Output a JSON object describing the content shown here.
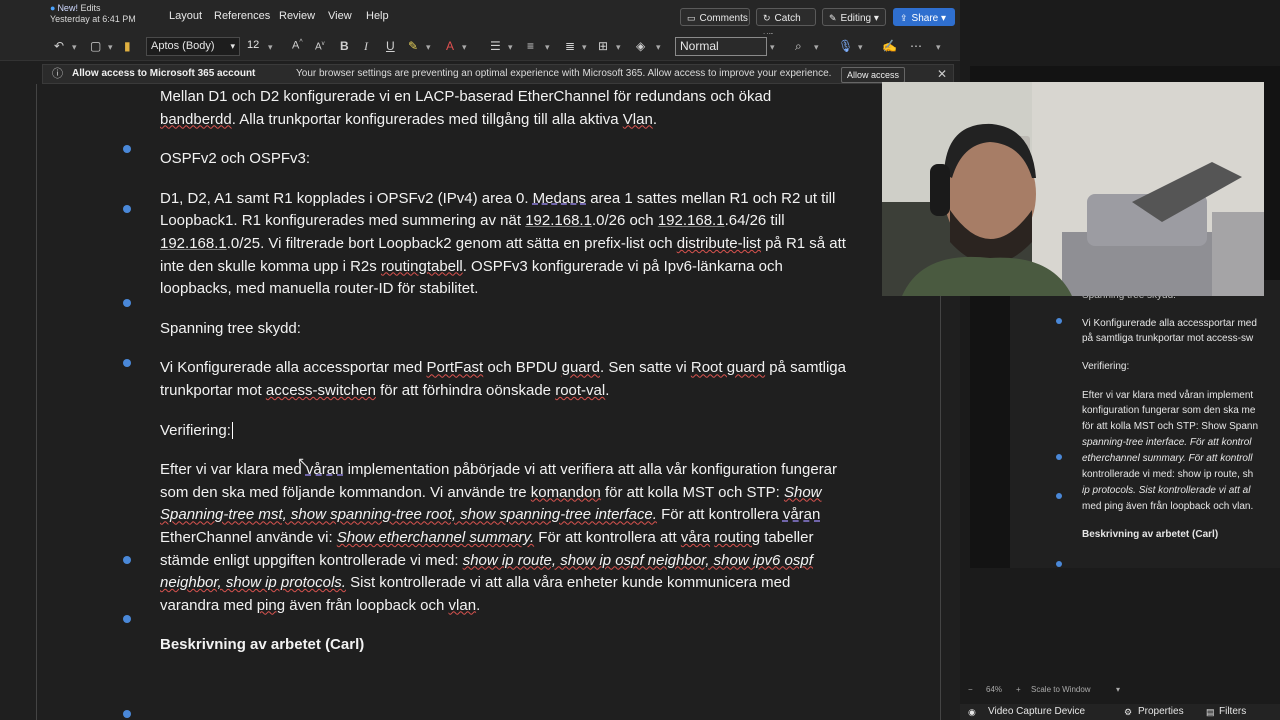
{
  "app": {
    "status_new": "New!",
    "status_edits": "Edits",
    "status_saved": "Yesterday at 6:41 PM"
  },
  "menu": [
    "Layout",
    "References",
    "Review",
    "View",
    "Help"
  ],
  "ribbon_buttons": {
    "comments": "Comments",
    "catch_up": "Catch up",
    "editing": "Editing",
    "share": "Share"
  },
  "toolbar": {
    "font_name": "Aptos (Body)",
    "font_size": "12",
    "style": "Normal"
  },
  "banner": {
    "title": "Allow access to Microsoft 365 account",
    "message": "Your browser settings are preventing an optimal experience with Microsoft 365. Allow access to improve your experience.",
    "button": "Allow access"
  },
  "document": {
    "p1a": "Mellan D1 och D2 konfigurerade vi en LACP-baserad EtherChannel för redundans och ökad",
    "p1b_w": "bandberdd",
    "p1b_rest": ". Alla trunkportar konfigurerades med tillgång till alla aktiva ",
    "p1b_vlan": "Vlan",
    "p1b_end": ".",
    "h_ospf": "OSPFv2 och OSPFv3:",
    "ospf": [
      "D1, D2, A1 samt R1 kopplades i OPSFv2 (IPv4) area 0. ",
      "Medans",
      " area 1 sattes mellan R1 och R2 ut till Loopback1. R1 konfigurerades med summering av nät ",
      "192.168.1",
      ".0/26 och ",
      "192.168.1",
      ".64/26 till ",
      "192.168.1",
      ".0/25. Vi filtrerade bort Loopback2 genom att sätta en prefix-list och ",
      "distribute-list",
      " på R1 så att inte den skulle komma upp i R2s ",
      "routingtabell",
      ". OSPFv3 konfigurerade vi på Ipv6-länkarna och loopbacks, med manuella router-ID för stabilitet."
    ],
    "h_stp": "Spanning tree skydd:",
    "stp": [
      "Vi Konfigurerade alla accessportar med ",
      "PortFast",
      " och BPDU ",
      "guard",
      ". Sen satte vi ",
      "Root guard",
      " på samtliga trunkportar mot ",
      "access-switchen",
      " för att förhindra oönskade ",
      "root-val",
      "."
    ],
    "h_verif": "Verifiering:",
    "verif": [
      "Efter vi var klara med ",
      "våran",
      " implementation påbörjade vi att verifiera att alla vår konfiguration fungerar som den ska med följande kommandon. Vi använde tre ",
      "komandon",
      " för att kolla MST och STP: ",
      "Show Spanning-tree mst, show spanning-tree root, show spanning-tree interface.",
      " För att kontrollera ",
      "våran",
      " EtherChannel använde vi: ",
      "Show etherchannel summary.",
      " För att kontrollera att ",
      "våra",
      " ",
      "routing",
      " tabeller stämde enligt uppgiften kontrollerade vi med: ",
      "show ip route, show ip ospf neighbor, show ipv6 ospf neighbor, show ip protocols.",
      " Sist kontrollerade vi att alla våra enheter kunde kommunicera med varandra med ",
      "ping",
      " även från loopback och ",
      "vlan",
      "."
    ],
    "h_carl": "Beskrivning av arbetet (Carl)"
  },
  "obs": {
    "mini_lines": [
      "Spanning tree skydd:",
      "Vi Konfigurerade alla accessportar med",
      "på samtliga trunkportar mot access-sw",
      "Verifiering:",
      "Efter vi var klara med våran implement",
      "konfiguration fungerar som den ska me",
      "för att kolla MST och STP: Show Spann",
      "spanning-tree interface. För att kontrol",
      "etherchannel summary. För att kontroll",
      "kontrollerade vi med: show ip route, sh",
      "ip protocols. Sist kontrollerade vi att al",
      "med ping även från loopback och vlan.",
      "Beskrivning av arbetet (Carl)"
    ],
    "zoom": "64%",
    "scale": "Scale to Window",
    "source": "Video Capture Device",
    "properties": "Properties",
    "filters": "Filters"
  },
  "colors": {
    "accent_blue": "#2f6fcf",
    "bullet_blue": "#4a88d8",
    "spell_red": "#d9534f",
    "grammar_purple": "#8b7dd8"
  }
}
